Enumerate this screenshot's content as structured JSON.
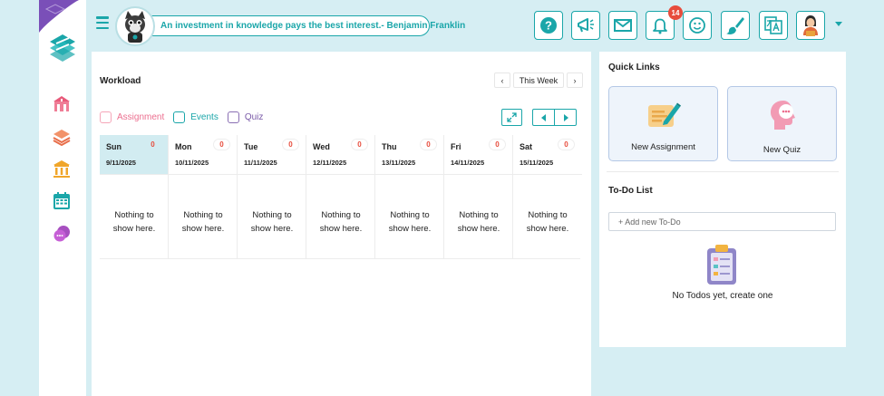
{
  "header": {
    "quote": "An investment in knowledge pays the best interest.- Benjamin Franklin",
    "notification_count": "14",
    "buttons": [
      "help-icon",
      "megaphone-icon",
      "mail-icon",
      "bell-icon",
      "smiley-icon",
      "paintbrush-icon",
      "translate-icon",
      "profile-icon"
    ]
  },
  "sidebar": {
    "items": [
      "logo-icon",
      "school-icon",
      "books-stack-icon",
      "institution-icon",
      "calendar-icon",
      "chat-bubbles-icon"
    ]
  },
  "workload": {
    "title": "Workload",
    "week_label": "This Week",
    "filters": {
      "assignment": "Assignment",
      "events": "Events",
      "quiz": "Quiz"
    },
    "days": [
      {
        "name": "Sun",
        "date": "9/11/2025",
        "count": "0",
        "empty_line1": "Nothing to",
        "empty_line2": "show here."
      },
      {
        "name": "Mon",
        "date": "10/11/2025",
        "count": "0",
        "empty_line1": "Nothing to",
        "empty_line2": "show here."
      },
      {
        "name": "Tue",
        "date": "11/11/2025",
        "count": "0",
        "empty_line1": "Nothing to",
        "empty_line2": "show here."
      },
      {
        "name": "Wed",
        "date": "12/11/2025",
        "count": "0",
        "empty_line1": "Nothing to",
        "empty_line2": "show here."
      },
      {
        "name": "Thu",
        "date": "13/11/2025",
        "count": "0",
        "empty_line1": "Nothing to",
        "empty_line2": "show here."
      },
      {
        "name": "Fri",
        "date": "14/11/2025",
        "count": "0",
        "empty_line1": "Nothing to",
        "empty_line2": "show here."
      },
      {
        "name": "Sat",
        "date": "15/11/2025",
        "count": "0",
        "empty_line1": "Nothing to",
        "empty_line2": "show here."
      }
    ]
  },
  "quick_links": {
    "title": "Quick Links",
    "new_assignment": "New Assignment",
    "new_quiz": "New Quiz"
  },
  "todo": {
    "title": "To-Do List",
    "placeholder": "+ Add new To-Do",
    "empty": "No Todos yet, create one"
  },
  "colors": {
    "accent": "#1aa6a9",
    "background": "#d6eef3",
    "badge": "#e74c3c",
    "assignment": "#ec6f8f",
    "quiz": "#7a5aa8"
  }
}
